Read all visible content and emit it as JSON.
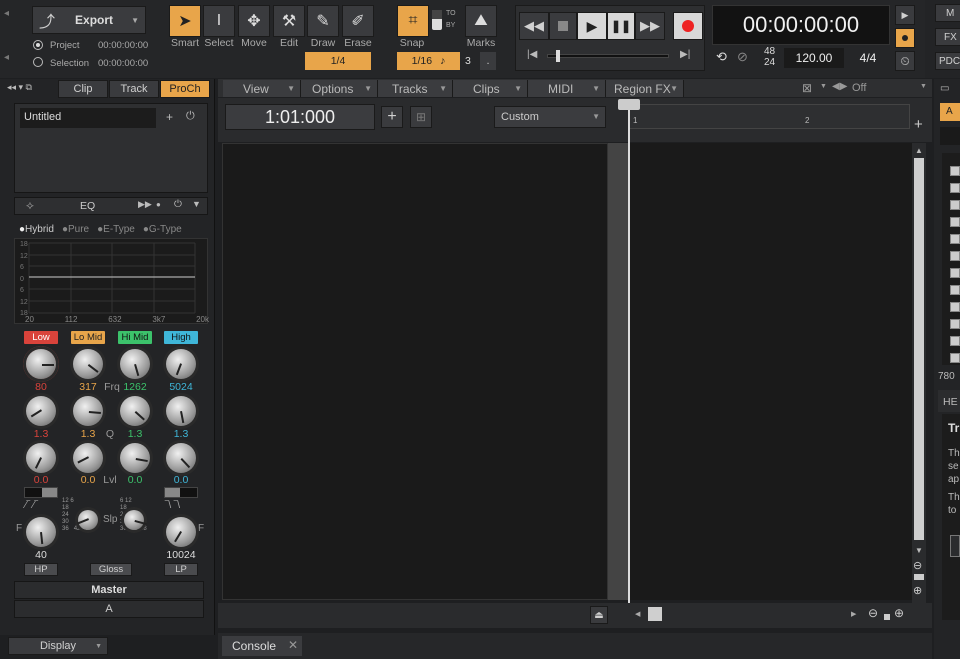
{
  "toolbar": {
    "export_label": "Export",
    "project_label": "Project",
    "project_time": "00:00:00:00",
    "selection_label": "Selection",
    "selection_time": "00:00:00:00",
    "tools": [
      {
        "name": "Smart"
      },
      {
        "name": "Select"
      },
      {
        "name": "Move"
      },
      {
        "name": "Edit"
      },
      {
        "name": "Draw"
      },
      {
        "name": "Erase"
      }
    ],
    "grid_value": "1/4",
    "snap_label": "Snap",
    "snap_value": "1/16",
    "marks_label": "Marks",
    "snap_to": "TO",
    "snap_by": "BY",
    "snap_count": "3",
    "snap_dot": "."
  },
  "transport": {
    "time": "00:00:00:00",
    "sample_rate_top": "48",
    "sample_rate_bottom": "24",
    "tempo": "120.00",
    "meter": "4/4"
  },
  "right_strip": {
    "m": "M",
    "fx": "FX",
    "pdc": "PDC"
  },
  "inspector": {
    "tabs": [
      "Clip",
      "Track",
      "ProCh"
    ],
    "preset_name": "Untitled",
    "eq_label": "EQ",
    "modes": [
      "Hybrid",
      "Pure",
      "E-Type",
      "G-Type"
    ],
    "y_ticks": [
      "18",
      "12",
      "6",
      "0",
      "6",
      "12",
      "18"
    ],
    "x_ticks": [
      "20",
      "112",
      "632",
      "3k7",
      "20k"
    ],
    "bands": [
      {
        "name": "Low",
        "color": "#d9433b",
        "freq": "80",
        "q": "1.3",
        "lvl": "0.0"
      },
      {
        "name": "Lo Mid",
        "color": "#e8a54a",
        "freq": "317",
        "q": "1.3",
        "lvl": "0.0"
      },
      {
        "name": "Hi Mid",
        "color": "#3cc26b",
        "freq": "1262",
        "q": "1.3",
        "lvl": "0.0"
      },
      {
        "name": "High",
        "color": "#3fb6d8",
        "freq": "5024",
        "q": "1.3",
        "lvl": "0.0"
      }
    ],
    "row_labels": {
      "frq": "Frq",
      "q": "Q",
      "lvl": "Lvl"
    },
    "slp_label": "Slp",
    "slope_ticks_left": [
      "12",
      "6",
      "18",
      "24",
      "30",
      "36",
      "42",
      "48"
    ],
    "slope_ticks_right": [
      "6",
      "12",
      "18",
      "24",
      "30",
      "36",
      "42",
      "48"
    ],
    "hp_freq": "40",
    "lp_freq": "10024",
    "f_left": "F",
    "f_right": "F",
    "hp_label": "HP",
    "gloss_label": "Gloss",
    "lp_label": "LP",
    "bus": "Master",
    "bus_sub": "A",
    "display_label": "Display"
  },
  "arrange": {
    "menus": [
      "View",
      "Options",
      "Tracks",
      "Clips",
      "MIDI",
      "Region FX"
    ],
    "off_label": "Off",
    "position": "1:01:000",
    "timebase": "Custom",
    "ruler": [
      "1",
      "2"
    ]
  },
  "console_label": "Console",
  "browser": {
    "tab": "A",
    "count": "780",
    "help_title": "HE",
    "help_head": "Tr",
    "help_lines": [
      "Th",
      "se",
      "ap",
      "Th",
      "to"
    ]
  }
}
